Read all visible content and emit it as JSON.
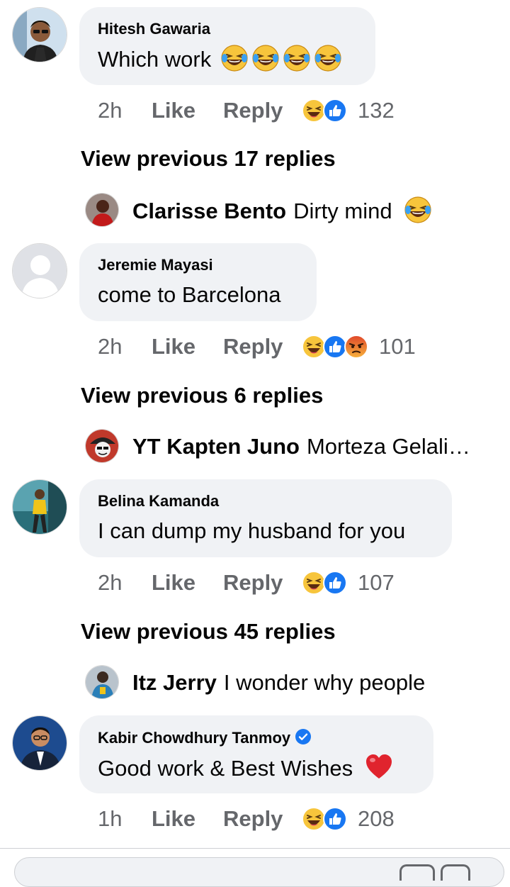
{
  "comments": [
    {
      "author": "Hitesh Gawaria",
      "text": "Which work",
      "time": "2h",
      "like": "Like",
      "reply": "Reply",
      "reactions": [
        "haha-icon",
        "like-icon"
      ],
      "count": "132",
      "emojis": [
        "laughing-tears-emoji",
        "laughing-tears-emoji",
        "laughing-tears-emoji",
        "laughing-tears-emoji"
      ]
    },
    {
      "author": "Jeremie Mayasi",
      "text": "come to Barcelona",
      "time": "2h",
      "like": "Like",
      "reply": "Reply",
      "reactions": [
        "haha-icon",
        "like-icon",
        "angry-icon"
      ],
      "count": "101"
    },
    {
      "author": "Belina Kamanda",
      "text": "I can dump my husband for you",
      "time": "2h",
      "like": "Like",
      "reply": "Reply",
      "reactions": [
        "haha-icon",
        "like-icon"
      ],
      "count": "107"
    },
    {
      "author": "Kabir Chowdhury Tanmoy",
      "verified": true,
      "text": "Good work & Best Wishes",
      "time": "1h",
      "like": "Like",
      "reply": "Reply",
      "reactions": [
        "haha-icon",
        "like-icon"
      ],
      "count": "208",
      "emojis": [
        "red-heart-emoji"
      ]
    }
  ],
  "threads": [
    {
      "view_previous": "View previous 17 replies",
      "reply_author": "Clarisse Bento",
      "reply_text": "Dirty mind",
      "reply_emoji": "laughing-tears-emoji"
    },
    {
      "view_previous": "View previous 6 replies",
      "reply_author": "YT Kapten Juno",
      "reply_text": "Morteza Gelalipour"
    },
    {
      "view_previous": "View previous 45 replies",
      "reply_author": "Itz Jerry",
      "reply_text": "I wonder why people"
    }
  ],
  "colors": {
    "bubble": "#f0f2f5",
    "meta_text": "#65676b",
    "like_blue": "#1877f2",
    "haha_yellow": "#f7c53c",
    "angry_orange": "#e9710f",
    "heart_red": "#e0242e"
  },
  "composer": {
    "icons": [
      "camera-icon",
      "gif-icon"
    ]
  }
}
